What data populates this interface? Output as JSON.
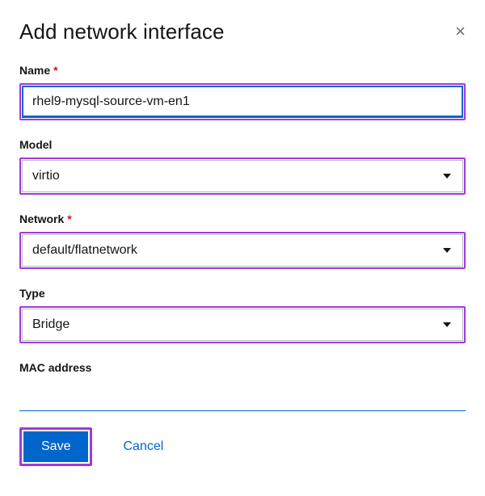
{
  "dialog": {
    "title": "Add network interface",
    "close_glyph": "×"
  },
  "fields": {
    "name": {
      "label": "Name",
      "required": true,
      "value": "rhel9-mysql-source-vm-en1"
    },
    "model": {
      "label": "Model",
      "required": false,
      "value": "virtio"
    },
    "network": {
      "label": "Network",
      "required": true,
      "value": "default/flatnetwork"
    },
    "type": {
      "label": "Type",
      "required": false,
      "value": "Bridge"
    },
    "mac": {
      "label": "MAC address",
      "required": false,
      "value": ""
    }
  },
  "actions": {
    "save": "Save",
    "cancel": "Cancel"
  },
  "required_glyph": "*"
}
